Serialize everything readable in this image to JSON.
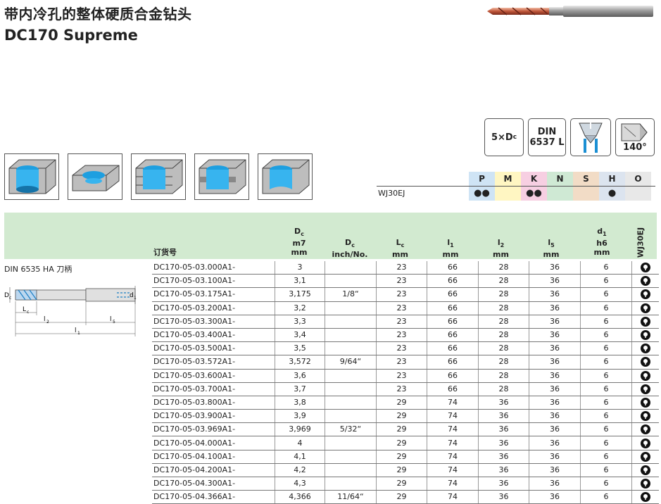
{
  "title": "带内冷孔的整体硬质合金钻头",
  "subtitle": "DC170 Supreme",
  "badges": {
    "depth": "5×D",
    "depth_sub": "c",
    "din_line1": "DIN",
    "din_line2": "6537 L",
    "angle": "140°"
  },
  "grades": {
    "headers": [
      "P",
      "M",
      "K",
      "N",
      "S",
      "H",
      "O"
    ],
    "colors": [
      "#cfe4f5",
      "#fff6c2",
      "#f7cfe2",
      "#cfe9d4",
      "#f2dcc6",
      "#dce4ef",
      "#e8e8e8"
    ],
    "row_name": "WJ30EJ",
    "row_marks": [
      "●●",
      "",
      "●●",
      "",
      "",
      "●",
      ""
    ]
  },
  "table": {
    "col_order_no": "订货号",
    "col_dc_l1": "D",
    "col_dc_sub": "c",
    "col_dc_l2": "m7",
    "col_dc_l3": "mm",
    "col_dcinch_l1": "D",
    "col_dcinch_sub": "c",
    "col_dcinch_l2": "inch/No.",
    "col_lc_l1": "L",
    "col_lc_sub": "c",
    "col_lc_l2": "mm",
    "col_l1_l1": "l",
    "col_l1_sub": "1",
    "col_l1_l2": "mm",
    "col_l2_l1": "l",
    "col_l2_sub": "2",
    "col_l2_l2": "mm",
    "col_l5_l1": "l",
    "col_l5_sub": "5",
    "col_l5_l2": "mm",
    "col_d1_l1": "d",
    "col_d1_sub": "1",
    "col_d1_l2": "h6",
    "col_d1_l3": "mm",
    "col_grade": "WJ30EJ",
    "shank_label": "DIN 6535 HA 刀柄",
    "rows": [
      [
        "DC170-05-03.000A1-",
        "3",
        "",
        "23",
        "66",
        "28",
        "36",
        "6"
      ],
      [
        "DC170-05-03.100A1-",
        "3,1",
        "",
        "23",
        "66",
        "28",
        "36",
        "6"
      ],
      [
        "DC170-05-03.175A1-",
        "3,175",
        "1/8“",
        "23",
        "66",
        "28",
        "36",
        "6"
      ],
      [
        "DC170-05-03.200A1-",
        "3,2",
        "",
        "23",
        "66",
        "28",
        "36",
        "6"
      ],
      [
        "DC170-05-03.300A1-",
        "3,3",
        "",
        "23",
        "66",
        "28",
        "36",
        "6"
      ],
      [
        "DC170-05-03.400A1-",
        "3,4",
        "",
        "23",
        "66",
        "28",
        "36",
        "6"
      ],
      [
        "DC170-05-03.500A1-",
        "3,5",
        "",
        "23",
        "66",
        "28",
        "36",
        "6"
      ],
      [
        "DC170-05-03.572A1-",
        "3,572",
        "9/64“",
        "23",
        "66",
        "28",
        "36",
        "6"
      ],
      [
        "DC170-05-03.600A1-",
        "3,6",
        "",
        "23",
        "66",
        "28",
        "36",
        "6"
      ],
      [
        "DC170-05-03.700A1-",
        "3,7",
        "",
        "23",
        "66",
        "28",
        "36",
        "6"
      ],
      [
        "DC170-05-03.800A1-",
        "3,8",
        "",
        "29",
        "74",
        "36",
        "36",
        "6"
      ],
      [
        "DC170-05-03.900A1-",
        "3,9",
        "",
        "29",
        "74",
        "36",
        "36",
        "6"
      ],
      [
        "DC170-05-03.969A1-",
        "3,969",
        "5/32“",
        "29",
        "74",
        "36",
        "36",
        "6"
      ],
      [
        "DC170-05-04.000A1-",
        "4",
        "",
        "29",
        "74",
        "36",
        "36",
        "6"
      ],
      [
        "DC170-05-04.100A1-",
        "4,1",
        "",
        "29",
        "74",
        "36",
        "36",
        "6"
      ],
      [
        "DC170-05-04.200A1-",
        "4,2",
        "",
        "29",
        "74",
        "36",
        "36",
        "6"
      ],
      [
        "DC170-05-04.300A1-",
        "4,3",
        "",
        "29",
        "74",
        "36",
        "36",
        "6"
      ],
      [
        "DC170-05-04.366A1-",
        "4,366",
        "11/64“",
        "29",
        "74",
        "36",
        "36",
        "6"
      ]
    ]
  },
  "drawing_labels": {
    "dc": "D",
    "dc_sub": "c",
    "d1": "d",
    "d1_sub": "1",
    "lc": "L",
    "lc_sub": "c",
    "l2": "l",
    "l2_sub": "2",
    "l5": "l",
    "l5_sub": "5",
    "l1": "l",
    "l1_sub": "1"
  }
}
